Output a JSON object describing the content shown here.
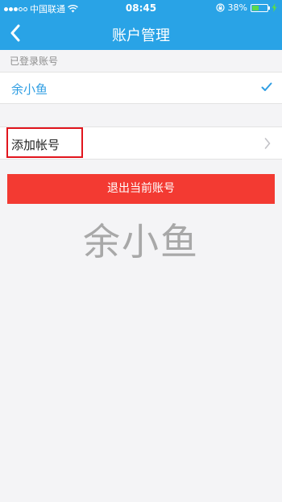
{
  "status_bar": {
    "carrier": "中国联通",
    "time": "08:45",
    "battery": "38%",
    "battery_level": 0.38,
    "signal_bars_filled": 3,
    "signal_bars_total": 5,
    "icons": [
      "signal-icon",
      "wifi-icon",
      "rotation-lock-icon",
      "battery-icon",
      "charging-icon"
    ]
  },
  "nav": {
    "title": "账户管理",
    "back_icon": "chevron-left-icon"
  },
  "accounts": {
    "section_label": "已登录账号",
    "items": [
      {
        "name": "余小鱼",
        "selected": true
      }
    ]
  },
  "add_account": {
    "label": "添加帐号"
  },
  "logout": {
    "label": "退出当前账号"
  },
  "watermark": {
    "text": "余小鱼"
  },
  "colors": {
    "header": "#29a3e6",
    "accent_text": "#2f9ee3",
    "logout": "#f33a32",
    "highlight": "#e1151d",
    "background": "#f4f4f6"
  }
}
